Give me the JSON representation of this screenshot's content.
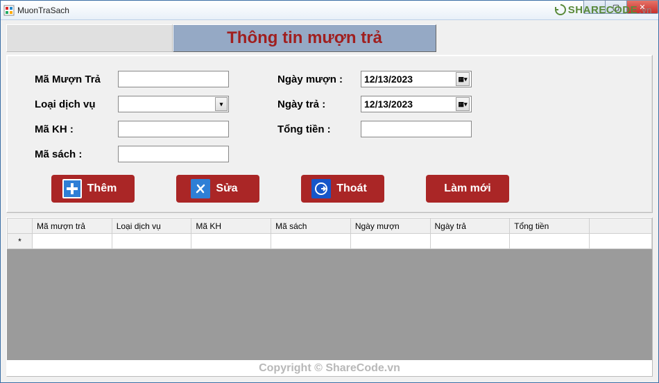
{
  "window": {
    "title": "MuonTraSach"
  },
  "header": {
    "title": "Thông tin mượn trả"
  },
  "form": {
    "labels": {
      "ma_muon_tra": "Mã Mượn Trả",
      "loai_dich_vu": "Loại dịch vụ",
      "ma_kh": "Mã KH :",
      "ma_sach": "Mã sách :",
      "ngay_muon": "Ngày mượn :",
      "ngay_tra": "Ngày trả :",
      "tong_tien": "Tổng tiền :"
    },
    "values": {
      "ma_muon_tra": "",
      "loai_dich_vu": "",
      "ma_kh": "",
      "ma_sach": "",
      "ngay_muon": "12/13/2023",
      "ngay_tra": "12/13/2023",
      "tong_tien": ""
    }
  },
  "buttons": {
    "them": "Thêm",
    "sua": "Sửa",
    "thoat": "Thoát",
    "lam_moi": "Làm mới"
  },
  "grid": {
    "columns": [
      "Mã mượn trả",
      "Loại dịch vụ",
      "Mã KH",
      "Mã sách",
      "Ngày mượn",
      "Ngày trả",
      "Tổng tiền"
    ],
    "new_row_marker": "*"
  },
  "watermark": {
    "logo_text": "SHARECODE",
    "suffix": ".vn",
    "copyright": "Copyright © ShareCode.vn"
  }
}
